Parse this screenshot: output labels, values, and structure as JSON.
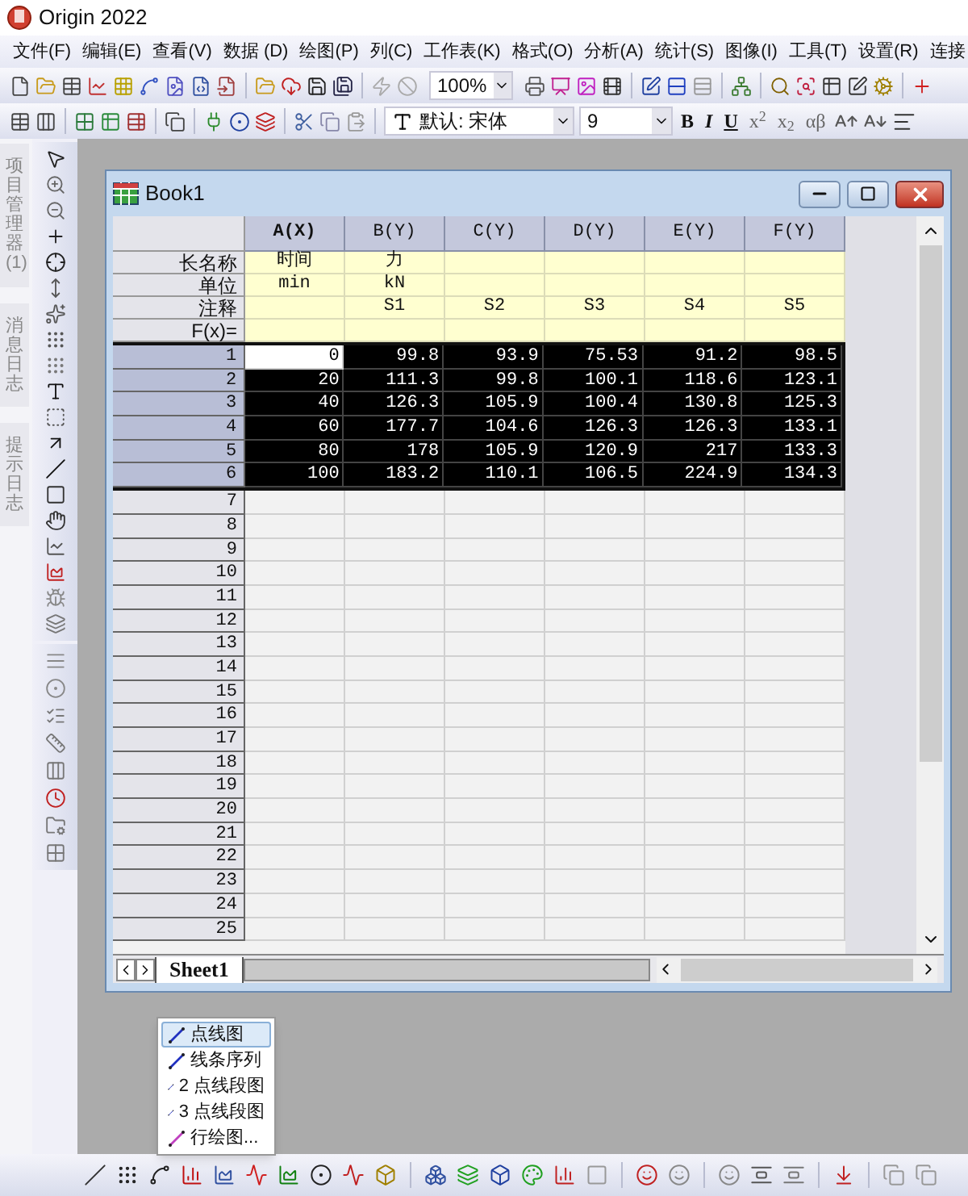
{
  "window": {
    "title": "Origin 2022"
  },
  "menu": [
    "文件(F)",
    "编辑(E)",
    "查看(V)",
    "数据 (D)",
    "绘图(P)",
    "列(C)",
    "工作表(K)",
    "格式(O)",
    "分析(A)",
    "统计(S)",
    "图像(I)",
    "工具(T)",
    "设置(R)",
    "连接"
  ],
  "toolbar": {
    "zoom": "100%",
    "font": "默认: 宋体",
    "font_size": "9",
    "format_buttons": [
      "B",
      "I",
      "U",
      "x$^{2}$",
      "x$_{2}$",
      "αβ"
    ]
  },
  "dock_tabs": [
    "项目管理器 (1)",
    "消息日志",
    "提示日志"
  ],
  "workbook": {
    "title": "Book1",
    "columns": [
      {
        "label": "A(X)",
        "kind": "x",
        "long_name": "时间",
        "units": "min"
      },
      {
        "label": "B(Y)",
        "kind": "y",
        "long_name": "力",
        "units": "kN",
        "comments": "S1"
      },
      {
        "label": "C(Y)",
        "kind": "y",
        "comments": "S2"
      },
      {
        "label": "D(Y)",
        "kind": "y",
        "comments": "S3"
      },
      {
        "label": "E(Y)",
        "kind": "y",
        "comments": "S4"
      },
      {
        "label": "F(Y)",
        "kind": "y",
        "comments": "S5"
      }
    ],
    "meta_rows": [
      "长名称",
      "单位",
      "注释",
      "F(x)="
    ],
    "rows": [
      {
        "label": "1",
        "selected": true,
        "cells": [
          {
            "value": "0",
            "active": true
          },
          {
            "value": "99.8",
            "active": false
          },
          {
            "value": "93.9",
            "active": false
          },
          {
            "value": "75.53",
            "active": false
          },
          {
            "value": "91.2",
            "active": false
          },
          {
            "value": "98.5",
            "active": false
          }
        ]
      },
      {
        "label": "2",
        "selected": true,
        "cells": [
          {
            "value": "20",
            "active": false
          },
          {
            "value": "111.3",
            "active": false
          },
          {
            "value": "99.8",
            "active": false
          },
          {
            "value": "100.1",
            "active": false
          },
          {
            "value": "118.6",
            "active": false
          },
          {
            "value": "123.1",
            "active": false
          }
        ]
      },
      {
        "label": "3",
        "selected": true,
        "cells": [
          {
            "value": "40",
            "active": false
          },
          {
            "value": "126.3",
            "active": false
          },
          {
            "value": "105.9",
            "active": false
          },
          {
            "value": "100.4",
            "active": false
          },
          {
            "value": "130.8",
            "active": false
          },
          {
            "value": "125.3",
            "active": false
          }
        ]
      },
      {
        "label": "4",
        "selected": true,
        "cells": [
          {
            "value": "60",
            "active": false
          },
          {
            "value": "177.7",
            "active": false
          },
          {
            "value": "104.6",
            "active": false
          },
          {
            "value": "126.3",
            "active": false
          },
          {
            "value": "126.3",
            "active": false
          },
          {
            "value": "133.1",
            "active": false
          }
        ]
      },
      {
        "label": "5",
        "selected": true,
        "cells": [
          {
            "value": "80",
            "active": false
          },
          {
            "value": "178",
            "active": false
          },
          {
            "value": "105.9",
            "active": false
          },
          {
            "value": "120.9",
            "active": false
          },
          {
            "value": "217",
            "active": false
          },
          {
            "value": "133.3",
            "active": false
          }
        ]
      },
      {
        "label": "6",
        "selected": true,
        "cells": [
          {
            "value": "100",
            "active": false
          },
          {
            "value": "183.2",
            "active": false
          },
          {
            "value": "110.1",
            "active": false
          },
          {
            "value": "106.5",
            "active": false
          },
          {
            "value": "224.9",
            "active": false
          },
          {
            "value": "134.3",
            "active": false
          }
        ]
      }
    ],
    "empty_rows": [
      "7",
      "8",
      "9",
      "10",
      "11",
      "12",
      "13",
      "14",
      "15",
      "16",
      "17",
      "18",
      "19",
      "20",
      "21",
      "22",
      "23",
      "24",
      "25"
    ],
    "sheet_tabs": [
      {
        "label": "Sheet1",
        "selected": true
      }
    ]
  },
  "popup_menu": [
    {
      "label": "点线图",
      "selected": true
    },
    {
      "label": "线条序列",
      "selected": false
    },
    {
      "label": "2 点线段图",
      "selected": false
    },
    {
      "label": "3 点线段图",
      "selected": false
    },
    {
      "label": "行绘图...",
      "selected": false
    }
  ]
}
